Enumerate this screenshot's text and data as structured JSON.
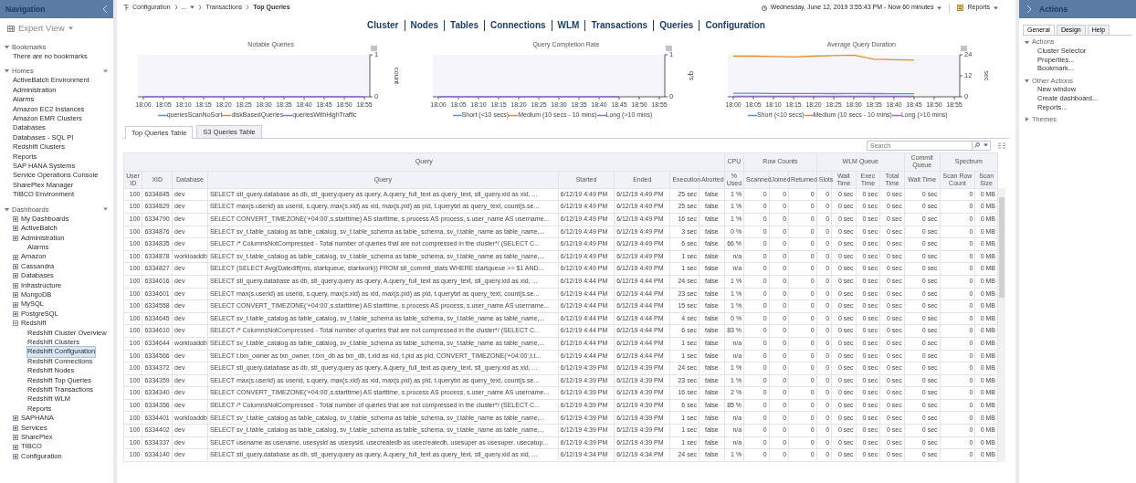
{
  "navigation": {
    "title": "Navigation",
    "view": "Expert View",
    "sections": [
      {
        "label": "Bookmarks",
        "expanded": true,
        "note": "There are no bookmarks"
      },
      {
        "label": "Homes",
        "expanded": true,
        "items": [
          {
            "label": "ActiveBatch Environment",
            "selected": false
          },
          {
            "label": "Administration",
            "selected": false
          },
          {
            "label": "Alarms",
            "selected": false
          },
          {
            "label": "Amazon EC2 Instances",
            "selected": false
          },
          {
            "label": "Amazon EMR Clusters",
            "selected": false
          },
          {
            "label": "Databases",
            "selected": false
          },
          {
            "label": "Databases - SQL PI",
            "selected": false
          },
          {
            "label": "Redshift Clusters",
            "selected": false
          },
          {
            "label": "Reports",
            "selected": false
          },
          {
            "label": "SAP HANA Systems",
            "selected": false
          },
          {
            "label": "Service Operations Console",
            "selected": false
          },
          {
            "label": "SharePlex Manager",
            "selected": false
          },
          {
            "label": "TIBCO Environment",
            "selected": false
          }
        ]
      },
      {
        "label": "Dashboards",
        "expanded": true,
        "items": [
          {
            "label": "My Dashboards",
            "expanded": false,
            "selected": false
          },
          {
            "label": "ActiveBatch",
            "expanded": false,
            "selected": false
          },
          {
            "label": "Administration",
            "expanded": false,
            "selected": false
          },
          {
            "label": "Alarms",
            "selected": false
          },
          {
            "label": "Amazon",
            "expanded": false,
            "selected": false
          },
          {
            "label": "Cassandra",
            "expanded": false,
            "selected": false
          },
          {
            "label": "Databases",
            "expanded": false,
            "selected": false
          },
          {
            "label": "Infrastructure",
            "expanded": false,
            "selected": false
          },
          {
            "label": "MongoDB",
            "expanded": false,
            "selected": false
          },
          {
            "label": "MySQL",
            "expanded": false,
            "selected": false
          },
          {
            "label": "PostgreSQL",
            "expanded": false,
            "selected": false
          },
          {
            "label": "Redshift",
            "expanded": true,
            "selected": false,
            "children": [
              {
                "label": "Redshift Cluster Overview",
                "selected": false
              },
              {
                "label": "Redshift Clusters",
                "selected": false
              },
              {
                "label": "Redshift Configuration",
                "selected": true
              },
              {
                "label": "Redshift Connections",
                "selected": false
              },
              {
                "label": "Redshift Nodes",
                "selected": false
              },
              {
                "label": "Redshift Top Queries",
                "selected": false
              },
              {
                "label": "Redshift Transactions",
                "selected": false
              },
              {
                "label": "Redshift WLM",
                "selected": false
              }
            ]
          },
          {
            "label": "Reports",
            "selected": false
          },
          {
            "label": "SAPHANA",
            "expanded": false,
            "selected": false
          },
          {
            "label": "Services",
            "expanded": false,
            "selected": false
          },
          {
            "label": "SharePlex",
            "expanded": false,
            "selected": false
          },
          {
            "label": "TIBCO",
            "expanded": false,
            "selected": false
          },
          {
            "label": "Configuration",
            "expanded": false,
            "selected": false
          }
        ]
      }
    ]
  },
  "breadcrumb": [
    "Configuration",
    "...",
    "Transactions",
    "Top Queries"
  ],
  "time_range": "Wednesday, June 12, 2019 3:55:43 PM - Now 60 minutes",
  "reports_button": "Reports",
  "section_links": [
    "Cluster",
    "Nodes",
    "Tables",
    "Connections",
    "WLM",
    "Transactions",
    "Queries",
    "Configuration"
  ],
  "charts": [
    {
      "chart_data": {
        "type": "line",
        "title": "Notable Queries",
        "ylabel": "count",
        "categories": [
          "18:00",
          "18:05",
          "18:10",
          "18:15",
          "18:20",
          "18:25",
          "18:30",
          "18:35",
          "18:40",
          "18:45",
          "18:50",
          "18:55"
        ],
        "yticks": [
          0,
          1
        ],
        "ylim": [
          0,
          1
        ],
        "legend": true,
        "series": [
          {
            "name": "queriesScanNoSort",
            "color": "#5b8fd9",
            "values": [
              null,
              null,
              null,
              null,
              null,
              null,
              null,
              null,
              null,
              null,
              null,
              null
            ]
          },
          {
            "name": "diskBasedQueries",
            "color": "#e0902a",
            "values": [
              null,
              null,
              null,
              null,
              null,
              null,
              null,
              null,
              null,
              null,
              null,
              null
            ]
          },
          {
            "name": "queriesWithHighTraffic",
            "color": "#9b6cc7",
            "values": [
              0,
              0,
              0,
              0,
              0,
              0,
              0,
              0,
              0,
              0,
              0,
              0
            ]
          }
        ]
      }
    },
    {
      "chart_data": {
        "type": "line",
        "title": "Query Completion Rate",
        "ylabel": "q/s",
        "categories": [
          "18:00",
          "18:05",
          "18:10",
          "18:15",
          "18:20",
          "18:25",
          "18:30",
          "18:35",
          "18:40",
          "18:45",
          "18:50",
          "18:55"
        ],
        "yticks": [
          0,
          1
        ],
        "ylim": [
          0,
          1
        ],
        "legend": true,
        "series": [
          {
            "name": "Short (<10 secs)",
            "color": "#5b8fd9",
            "values": [
              null,
              null,
              null,
              null,
              null,
              null,
              null,
              null,
              null,
              null,
              null,
              null
            ]
          },
          {
            "name": "Medium (10 secs - 10 mins)",
            "color": "#e0902a",
            "values": [
              null,
              null,
              null,
              null,
              null,
              null,
              null,
              null,
              null,
              null,
              null,
              null
            ]
          },
          {
            "name": "Long (>10 mins)",
            "color": "#9b6cc7",
            "values": [
              0,
              0,
              0,
              0,
              0,
              0,
              0,
              0,
              0,
              0,
              null,
              null
            ]
          }
        ]
      }
    },
    {
      "chart_data": {
        "type": "line",
        "title": "Average Query Duration",
        "ylabel": "sec",
        "categories": [
          "18:00",
          "18:05",
          "18:10",
          "18:15",
          "18:20",
          "18:25",
          "18:30",
          "18:35",
          "18:40",
          "18:45",
          "18:50",
          "18:55"
        ],
        "yticks": [
          0,
          12,
          24
        ],
        "ylim": [
          0,
          24
        ],
        "legend": true,
        "series": [
          {
            "name": "Short (<10 secs)",
            "color": "#5b8fd9",
            "values": [
              2,
              2,
              1.9,
              1.9,
              1.9,
              1.8,
              1.9,
              1.8,
              1.7,
              1.7,
              null,
              null
            ]
          },
          {
            "name": "Medium (10 secs - 10 mins)",
            "color": "#e0902a",
            "values": [
              23.2,
              23.2,
              23,
              22.8,
              23.2,
              23.6,
              23.8,
              21.5,
              21.2,
              21,
              null,
              null
            ]
          },
          {
            "name": "Long (>10 mins)",
            "color": "#9b6cc7",
            "values": [
              0.3,
              0.3,
              0.3,
              0.3,
              0.3,
              0.3,
              0.3,
              0.3,
              0.3,
              0.3,
              null,
              null
            ]
          }
        ]
      }
    }
  ],
  "table_tabs": [
    {
      "label": "Top Queries Table",
      "selected": true
    },
    {
      "label": "S3 Queries Table",
      "selected": false
    }
  ],
  "search": {
    "placeholder": "Search"
  },
  "table": {
    "column_groups": [
      {
        "label": "Query",
        "columns": [
          "User ID",
          "XID",
          "Database",
          "Query",
          "Started",
          "Ended",
          "Execution",
          "Aborted"
        ]
      },
      {
        "label": "CPU",
        "columns": [
          "% Used"
        ]
      },
      {
        "label": "Row Counts",
        "columns": [
          "Scanned",
          "Joined",
          "Returned"
        ]
      },
      {
        "label": "WLM Queue",
        "columns": [
          "Slots",
          "Wait Time",
          "Exec Time",
          "Total Time"
        ]
      },
      {
        "label": "Commit Queue",
        "columns": [
          "Wait Time"
        ]
      },
      {
        "label": "Spectrum",
        "columns": [
          "Scan Row Count",
          "Scan Size"
        ]
      }
    ],
    "rows": [
      [
        "100",
        "6334845",
        "dev",
        "SELECT stl_query.database as db, stl_query.query as query, A.query_full_text as query_text, stl_query.xid as xid, ...",
        "6/12/19 4:49 PM",
        "6/12/19 4:49 PM",
        "25 sec",
        "false",
        "1 %",
        "0",
        "0",
        "0",
        "0",
        "0 sec",
        "0 sec",
        "0 sec",
        "0 sec",
        "0",
        "0 MB"
      ],
      [
        "100",
        "6334829",
        "dev",
        "SELECT max(s.userid) as userid, s.query, max(s.xid) as xid, max(s.pid) as pid, t.querytxt as query_text, count(s.se...",
        "6/12/19 4:49 PM",
        "6/12/19 4:49 PM",
        "25 sec",
        "false",
        "1 %",
        "0",
        "0",
        "0",
        "0",
        "0 sec",
        "0 sec",
        "0 sec",
        "0 sec",
        "0",
        "0 MB"
      ],
      [
        "100",
        "6334790",
        "dev",
        "SELECT CONVERT_TIMEZONE('+04:00',s.starttime) AS starttime, s.process AS process, s.user_name AS username...",
        "6/12/19 4:49 PM",
        "6/12/19 4:49 PM",
        "16 sec",
        "false",
        "1 %",
        "0",
        "0",
        "0",
        "0",
        "0 sec",
        "0 sec",
        "0 sec",
        "0 sec",
        "0",
        "0 MB"
      ],
      [
        "100",
        "6334876",
        "dev",
        "SELECT sv_t.table_catalog as table_catalog, sv_t.table_schema as table_schema, sv_t.table_name as table_name,...",
        "6/12/19 4:49 PM",
        "6/12/19 4:49 PM",
        "3 sec",
        "false",
        "0 %",
        "0",
        "0",
        "0",
        "0",
        "0 sec",
        "0 sec",
        "0 sec",
        "0 sec",
        "0",
        "0 MB"
      ],
      [
        "100",
        "6334835",
        "dev",
        "SELECT /* ColumnsNotCompressed - Total number of queries that are not compressed in the cluster*/ (SELECT C...",
        "6/12/19 4:49 PM",
        "6/12/19 4:49 PM",
        "6 sec",
        "false",
        "66 %",
        "0",
        "0",
        "0",
        "0",
        "0 sec",
        "0 sec",
        "0 sec",
        "0 sec",
        "0",
        "0 MB"
      ],
      [
        "100",
        "6334878",
        "workloaddb",
        "SELECT sv_t.table_catalog as table_catalog, sv_t.table_schema as table_schema, sv_t.table_name as table_name,...",
        "6/12/19 4:49 PM",
        "6/12/19 4:49 PM",
        "1 sec",
        "false",
        "n/a",
        "0",
        "0",
        "0",
        "0",
        "0 sec",
        "0 sec",
        "0 sec",
        "0 sec",
        "0",
        "0 MB"
      ],
      [
        "100",
        "6334827",
        "dev",
        "SELECT (SELECT Avg(Datediff(ms, startqueue, startwork)) FROM stl_commit_stats WHERE startqueue >= $1 AND...",
        "6/12/19 4:49 PM",
        "6/12/19 4:49 PM",
        "1 sec",
        "false",
        "n/a",
        "0",
        "0",
        "0",
        "0",
        "0 sec",
        "0 sec",
        "0 sec",
        "0 sec",
        "0",
        "0 MB"
      ],
      [
        "100",
        "6334616",
        "dev",
        "SELECT stl_query.database as db, stl_query.query as query, A.query_full_text as query_text, stl_query.xid as xid, ...",
        "6/12/19 4:44 PM",
        "6/12/19 4:44 PM",
        "24 sec",
        "false",
        "1 %",
        "0",
        "0",
        "0",
        "0",
        "0 sec",
        "0 sec",
        "0 sec",
        "0 sec",
        "0",
        "0 MB"
      ],
      [
        "100",
        "6334601",
        "dev",
        "SELECT max(s.userid) as userid, s.query, max(s.xid) as xid, max(s.pid) as pid, t.querytxt as query_text, count(s.se...",
        "6/12/19 4:44 PM",
        "6/12/19 4:44 PM",
        "23 sec",
        "false",
        "1 %",
        "0",
        "0",
        "0",
        "0",
        "0 sec",
        "0 sec",
        "0 sec",
        "0 sec",
        "0",
        "0 MB"
      ],
      [
        "100",
        "6334558",
        "dev",
        "SELECT CONVERT_TIMEZONE('+04:00',s.starttime) AS starttime, s.process AS process, s.user_name AS username...",
        "6/12/19 4:44 PM",
        "6/12/19 4:44 PM",
        "15 sec",
        "false",
        "1 %",
        "0",
        "0",
        "0",
        "0",
        "0 sec",
        "0 sec",
        "0 sec",
        "0 sec",
        "0",
        "0 MB"
      ],
      [
        "100",
        "6334645",
        "dev",
        "SELECT sv_t.table_catalog as table_catalog, sv_t.table_schema as table_schema, sv_t.table_name as table_name,...",
        "6/12/19 4:44 PM",
        "6/12/19 4:44 PM",
        "4 sec",
        "false",
        "0 %",
        "0",
        "0",
        "0",
        "0",
        "0 sec",
        "0 sec",
        "0 sec",
        "0 sec",
        "0",
        "0 MB"
      ],
      [
        "100",
        "6334610",
        "dev",
        "SELECT /* ColumnsNotCompressed - Total number of queries that are not compressed in the cluster*/ (SELECT C...",
        "6/12/19 4:44 PM",
        "6/12/19 4:44 PM",
        "6 sec",
        "false",
        "83 %",
        "0",
        "0",
        "0",
        "0",
        "0 sec",
        "0 sec",
        "0 sec",
        "0 sec",
        "0",
        "0 MB"
      ],
      [
        "100",
        "6334644",
        "workloaddb",
        "SELECT sv_t.table_catalog as table_catalog, sv_t.table_schema as table_schema, sv_t.table_name as table_name,...",
        "6/12/19 4:44 PM",
        "6/12/19 4:44 PM",
        "1 sec",
        "false",
        "n/a",
        "0",
        "0",
        "0",
        "0",
        "0 sec",
        "0 sec",
        "0 sec",
        "0 sec",
        "0",
        "0 MB"
      ],
      [
        "100",
        "6334566",
        "dev",
        "SELECT t.txn_owner as txn_owner, t.txn_db as txn_db, t.xid as xid, t.pid as pid, CONVERT_TIMEZONE('+04:00',t.t...",
        "6/12/19 4:44 PM",
        "6/12/19 4:44 PM",
        "1 sec",
        "false",
        "n/a",
        "0",
        "0",
        "0",
        "0",
        "0 sec",
        "0 sec",
        "0 sec",
        "0 sec",
        "0",
        "0 MB"
      ],
      [
        "100",
        "6334372",
        "dev",
        "SELECT stl_query.database as db, stl_query.query as query, A.query_full_text as query_text, stl_query.xid as xid, ...",
        "6/12/19 4:39 PM",
        "6/12/19 4:39 PM",
        "24 sec",
        "false",
        "1 %",
        "0",
        "0",
        "0",
        "0",
        "0 sec",
        "0 sec",
        "0 sec",
        "0 sec",
        "0",
        "0 MB"
      ],
      [
        "100",
        "6334359",
        "dev",
        "SELECT max(s.userid) as userid, s.query, max(s.xid) as xid, max(s.pid) as pid, t.querytxt as query_text, count(s.se...",
        "6/12/19 4:39 PM",
        "6/12/19 4:39 PM",
        "23 sec",
        "false",
        "1 %",
        "0",
        "0",
        "0",
        "0",
        "0 sec",
        "0 sec",
        "0 sec",
        "0 sec",
        "0",
        "0 MB"
      ],
      [
        "100",
        "6334340",
        "dev",
        "SELECT CONVERT_TIMEZONE('+04:00',s.starttime) AS starttime, s.process AS process, s.user_name AS username...",
        "6/12/19 4:39 PM",
        "6/12/19 4:39 PM",
        "16 sec",
        "false",
        "2 %",
        "0",
        "0",
        "0",
        "0",
        "0 sec",
        "0 sec",
        "0 sec",
        "0 sec",
        "0",
        "0 MB"
      ],
      [
        "100",
        "6334356",
        "dev",
        "SELECT /* ColumnsNotCompressed - Total number of queries that are not compressed in the cluster*/ (SELECT C...",
        "6/12/19 4:39 PM",
        "6/12/19 4:39 PM",
        "6 sec",
        "false",
        "85 %",
        "0",
        "0",
        "0",
        "0",
        "0 sec",
        "0 sec",
        "0 sec",
        "0 sec",
        "0",
        "0 MB"
      ],
      [
        "100",
        "6334401",
        "workloaddb",
        "SELECT sv_t.table_catalog as table_catalog, sv_t.table_schema as table_schema, sv_t.table_name as table_name,...",
        "6/12/19 4:39 PM",
        "6/12/19 4:39 PM",
        "1 sec",
        "false",
        "n/a",
        "0",
        "0",
        "0",
        "0",
        "0 sec",
        "0 sec",
        "0 sec",
        "0 sec",
        "0",
        "0 MB"
      ],
      [
        "100",
        "6334402",
        "dev",
        "SELECT sv_t.table_catalog as table_catalog, sv_t.table_schema as table_schema, sv_t.table_name as table_name,...",
        "6/12/19 4:39 PM",
        "6/12/19 4:39 PM",
        "1 sec",
        "false",
        "n/a",
        "0",
        "0",
        "0",
        "0",
        "0 sec",
        "0 sec",
        "0 sec",
        "0 sec",
        "0",
        "0 MB"
      ],
      [
        "100",
        "6334337",
        "dev",
        "SELECT usename as usename, usesysid as usesysid, usecreatedb as usecreatedb, usesuper as usesuper, usecatup...",
        "6/12/19 4:39 PM",
        "6/12/19 4:39 PM",
        "1 sec",
        "false",
        "n/a",
        "0",
        "0",
        "0",
        "0",
        "0 sec",
        "0 sec",
        "0 sec",
        "0 sec",
        "0",
        "0 MB"
      ],
      [
        "100",
        "6334140",
        "dev",
        "SELECT stl_query.database as db, stl_query.query as query, A.query_full_text as query_text, stl_query.xid as xid, ...",
        "6/12/19 4:34 PM",
        "6/12/19 4:34 PM",
        "24 sec",
        "false",
        "1 %",
        "0",
        "0",
        "0",
        "0",
        "0 sec",
        "0 sec",
        "0 sec",
        "0 sec",
        "0",
        "0 MB"
      ]
    ]
  },
  "actions_panel": {
    "title": "Actions",
    "tabs": [
      {
        "label": "General",
        "selected": true
      },
      {
        "label": "Design",
        "selected": false
      },
      {
        "label": "Help",
        "selected": false
      }
    ],
    "sections": [
      {
        "label": "Actions",
        "expanded": true,
        "items": [
          "Cluster Selector",
          "Properties...",
          "Bookmark..."
        ]
      },
      {
        "label": "Other Actions",
        "expanded": true,
        "items": [
          "New window",
          "Create dashboard...",
          "Reports..."
        ]
      },
      {
        "label": "Themes",
        "expanded": false
      }
    ]
  }
}
